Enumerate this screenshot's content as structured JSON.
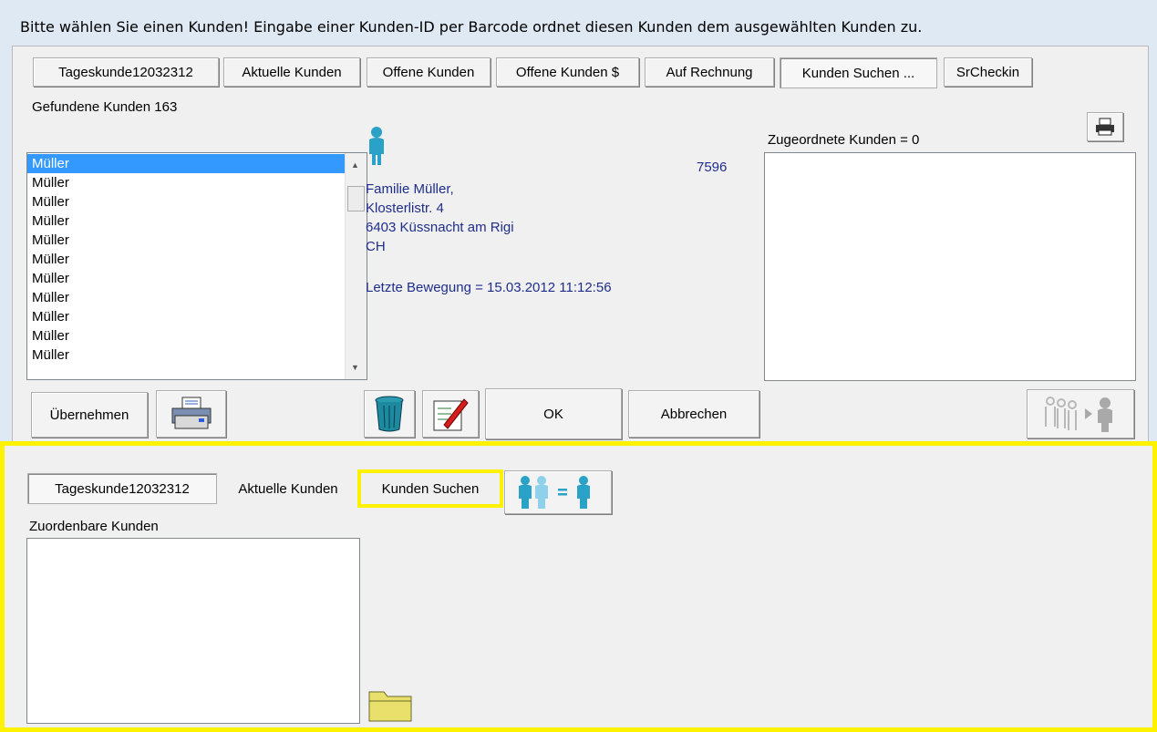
{
  "title_bar": {
    "text": "Bitte wählen Sie einen Kunden! Eingabe einer Kunden-ID per Barcode ordnet diesen Kunden dem ausgewählten Kunden zu."
  },
  "tabs_top": [
    {
      "label": "Tageskunde12032312"
    },
    {
      "label": "Aktuelle Kunden"
    },
    {
      "label": "Offene Kunden"
    },
    {
      "label": "Offene Kunden $"
    },
    {
      "label": "Auf Rechnung"
    },
    {
      "label": "Kunden Suchen ..."
    },
    {
      "label": "SrCheckin"
    }
  ],
  "found_label": "Gefundene Kunden 163",
  "customer_list": [
    "Müller",
    "Müller",
    "Müller",
    "Müller",
    "Müller",
    "Müller",
    "Müller",
    "Müller",
    "Müller",
    "Müller",
    "Müller"
  ],
  "details": {
    "id": "7596",
    "name": "Familie Müller,",
    "street": "Klosterlistr. 4",
    "city": "6403 Küssnacht am Rigi",
    "country": "CH",
    "last_move": "Letzte Bewegung = 15.03.2012 11:12:56"
  },
  "assigned_label": "Zugeordnete Kunden = 0",
  "buttons": {
    "take_over": "Übernehmen",
    "ok": "OK",
    "cancel": "Abbrechen"
  },
  "bottom": {
    "tabs": [
      {
        "label": "Tageskunde12032312"
      },
      {
        "label": "Aktuelle Kunden"
      },
      {
        "label": "Kunden Suchen"
      }
    ],
    "assignable_label": "Zuordenbare Kunden"
  },
  "colors": {
    "highlight": "#fff200",
    "selection": "#3399ff",
    "detail_text": "#1f2d8a"
  }
}
